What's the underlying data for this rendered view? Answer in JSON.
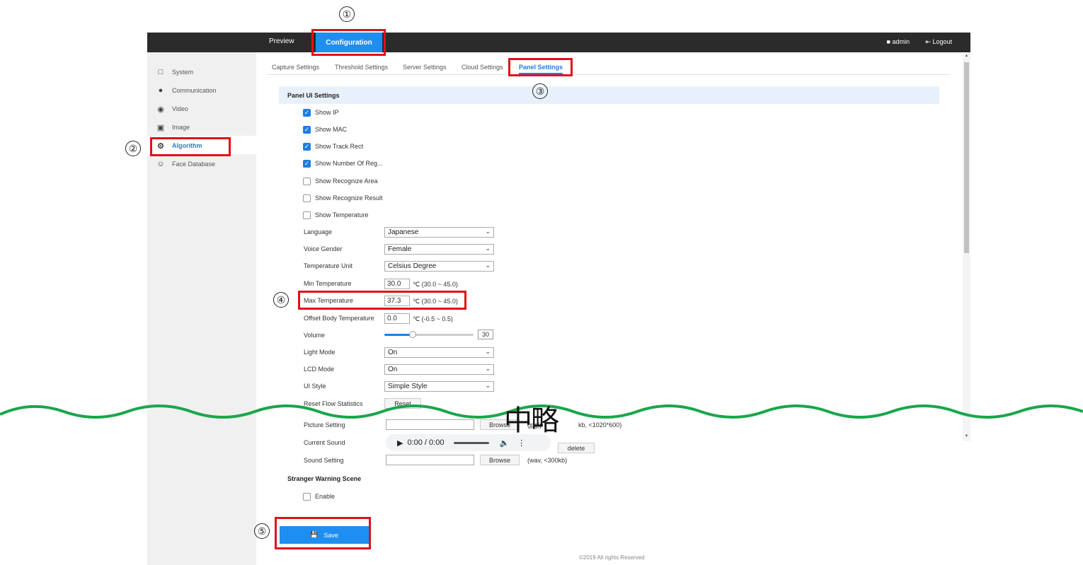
{
  "topbar": {
    "preview": "Preview",
    "configuration": "Configuration",
    "user": "admin",
    "logout": "Logout"
  },
  "sidebar": {
    "items": [
      {
        "label": "System",
        "icon": "monitor-icon"
      },
      {
        "label": "Communication",
        "icon": "globe-icon"
      },
      {
        "label": "Video",
        "icon": "video-icon"
      },
      {
        "label": "Image",
        "icon": "image-icon"
      },
      {
        "label": "Algorithm",
        "icon": "algorithm-icon"
      },
      {
        "label": "Face Database",
        "icon": "face-icon"
      }
    ]
  },
  "tabs": [
    "Capture Settings",
    "Threshold Settings",
    "Server Settings",
    "Cloud Settings",
    "Panel Settings"
  ],
  "section_title": "Panel UI Settings",
  "checkboxes": [
    {
      "label": "Show IP",
      "checked": true
    },
    {
      "label": "Show MAC",
      "checked": true
    },
    {
      "label": "Show Track Rect",
      "checked": true
    },
    {
      "label": "Show Number Of Reg...",
      "checked": true
    },
    {
      "label": "Show Recognize Area",
      "checked": false
    },
    {
      "label": "Show Recognize Result",
      "checked": false
    },
    {
      "label": "Show Temperature",
      "checked": false
    }
  ],
  "fields": {
    "language": {
      "label": "Language",
      "value": "Japanese"
    },
    "voice_gender": {
      "label": "Voice Gender",
      "value": "Female"
    },
    "temp_unit": {
      "label": "Temperature Unit",
      "value": "Celsius Degree"
    },
    "min_temp": {
      "label": "Min Temperature",
      "value": "30.0",
      "range": "℃ (30.0 ~ 45.0)"
    },
    "max_temp": {
      "label": "Max Temperature",
      "value": "37.3",
      "range": "℃ (30.0 ~ 45.0)"
    },
    "offset_temp": {
      "label": "Offset Body Temperature",
      "value": "0.0",
      "range": "℃ (-0.5 ~ 0.5)"
    },
    "volume": {
      "label": "Volume",
      "value": "30",
      "level_percent": 30
    },
    "light_mode": {
      "label": "Light Mode",
      "value": "On"
    },
    "lcd_mode": {
      "label": "LCD Mode",
      "value": "On"
    },
    "ui_style": {
      "label": "UI Style",
      "value": "Simple Style"
    },
    "reset_flow": {
      "label": "Reset Flow Statistics",
      "button": "Reset"
    },
    "picture": {
      "label": "Picture Setting",
      "button": "Browse",
      "hint": "(jpg|png, <200kb, <1020*600)",
      "hint_visible": "(jpg|p",
      "hint_tail": "kb, <1020*600)"
    },
    "current_sound": {
      "label": "Current Sound",
      "time": "0:00 / 0:00",
      "delete": "delete"
    },
    "sound": {
      "label": "Sound Setting",
      "button": "Browse",
      "hint": "(wav, <300kb)"
    }
  },
  "stranger": {
    "title": "Stranger Warning Scene",
    "enable": "Enable"
  },
  "save": "Save",
  "footer": "©2019 All rights Reserved",
  "annotations": {
    "n1": "①",
    "n2": "②",
    "n3": "③",
    "n4": "④",
    "n5": "⑤",
    "omitted": "中略"
  },
  "colors": {
    "accent": "#1f8ef1",
    "highlight": "#e0101a",
    "wave": "#1aa64b"
  }
}
